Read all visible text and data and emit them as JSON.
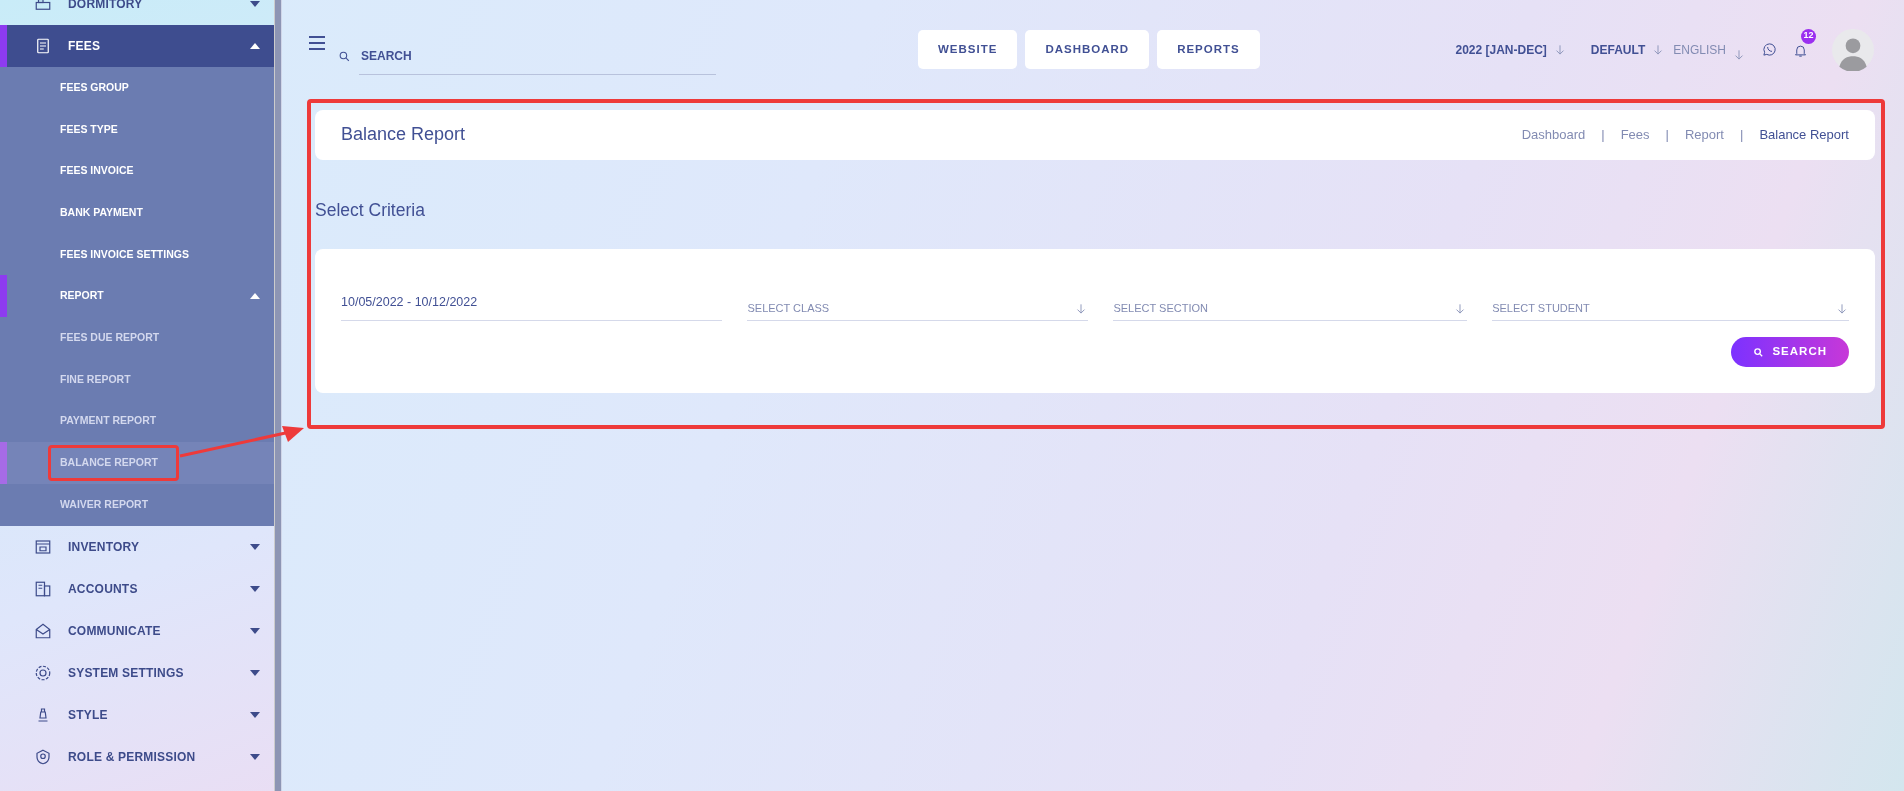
{
  "sidebar": {
    "items": [
      {
        "label": "DORMITORY",
        "expanded": false,
        "selected": false
      },
      {
        "label": "FEES",
        "expanded": true,
        "selected": true,
        "children": [
          {
            "label": "FEES GROUP",
            "selected": false
          },
          {
            "label": "FEES TYPE",
            "selected": false
          },
          {
            "label": "FEES INVOICE",
            "selected": false
          },
          {
            "label": "BANK PAYMENT",
            "selected": false
          },
          {
            "label": "FEES INVOICE SETTINGS",
            "selected": false
          },
          {
            "label": "REPORT",
            "selected": true,
            "expanded": true,
            "children": [
              {
                "label": "FEES DUE REPORT",
                "selected": false,
                "annotated": false
              },
              {
                "label": "FINE REPORT",
                "selected": false,
                "annotated": false
              },
              {
                "label": "PAYMENT REPORT",
                "selected": false,
                "annotated": false
              },
              {
                "label": "BALANCE REPORT",
                "selected": true,
                "annotated": true
              },
              {
                "label": "WAIVER REPORT",
                "selected": false,
                "annotated": false
              }
            ]
          }
        ]
      },
      {
        "label": "INVENTORY",
        "expanded": false,
        "selected": false
      },
      {
        "label": "ACCOUNTS",
        "expanded": false,
        "selected": false
      },
      {
        "label": "COMMUNICATE",
        "expanded": false,
        "selected": false
      },
      {
        "label": "SYSTEM SETTINGS",
        "expanded": false,
        "selected": false
      },
      {
        "label": "STYLE",
        "expanded": false,
        "selected": false
      },
      {
        "label": "ROLE & PERMISSION",
        "expanded": false,
        "selected": false
      }
    ]
  },
  "topbar": {
    "search": {
      "placeholder": "SEARCH"
    },
    "buttons": [
      "WEBSITE",
      "DASHBOARD",
      "REPORTS"
    ],
    "session": "2022 [JAN-DEC]",
    "theme": "DEFAULT",
    "language": "ENGLISH",
    "notification_count": "12"
  },
  "main": {
    "annotated": true,
    "page_header": {
      "title": "Balance Report",
      "breadcrumb": [
        {
          "label": "Dashboard",
          "current": false,
          "separator": "|"
        },
        {
          "label": "Fees",
          "current": false,
          "separator": "|"
        },
        {
          "label": "Report",
          "current": false,
          "separator": "|"
        },
        {
          "label": "Balance Report",
          "current": true
        }
      ]
    },
    "criteria": {
      "title": "Select Criteria",
      "date_range": "10/05/2022 - 10/12/2022",
      "selects": [
        {
          "placeholder": "SELECT CLASS"
        },
        {
          "placeholder": "SELECT SECTION"
        },
        {
          "placeholder": "SELECT STUDENT"
        }
      ],
      "search_button": "SEARCH"
    }
  }
}
